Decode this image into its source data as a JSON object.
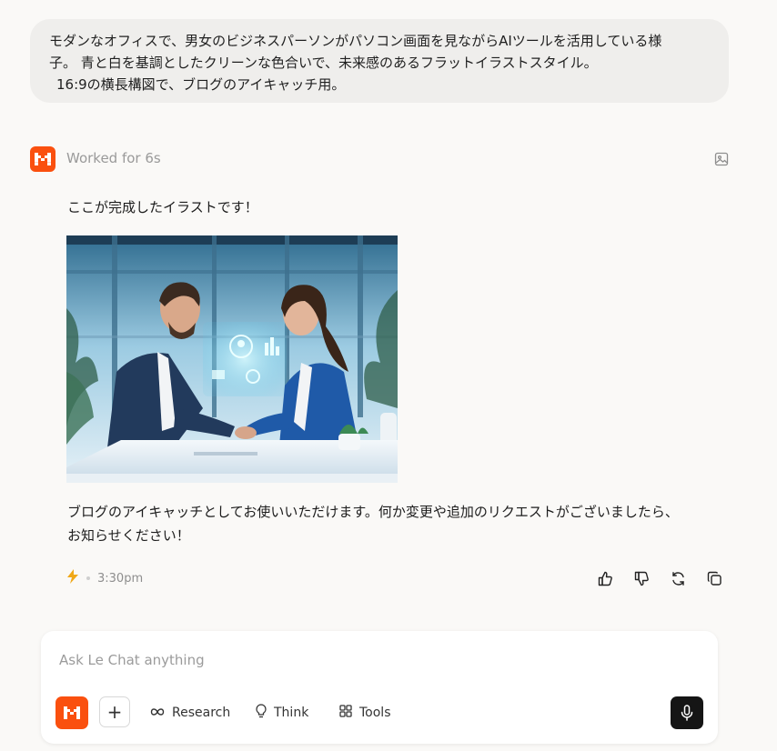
{
  "user_message": {
    "line1": "モダンなオフィスで、男女のビジネスパーソンがパソコン画面を見ながらAIツールを活用している様",
    "line2": "子。  青と白を基調としたクリーンな色合いで、未来感のあるフラットイラストスタイル。",
    "line3": "16:9の横長構図で、ブログのアイキャッチ用。"
  },
  "assistant": {
    "status": "Worked for 6s",
    "intro": "ここが完成したイラストです！",
    "outro_line1": "ブログのアイキャッチとしてお使いいただけます。何か変更や追加のリクエストがございましたら、",
    "outro_line2": "お知らせください！",
    "time": "3:30pm"
  },
  "composer": {
    "placeholder": "Ask Le Chat anything",
    "plus_label": "+",
    "research_label": "Research",
    "think_label": "Think",
    "tools_label": "Tools"
  },
  "icons": {
    "brand": "mistral-logo-icon",
    "image": "image-icon",
    "flash": "lightning-icon",
    "like": "thumbs-up-icon",
    "dislike": "thumbs-down-icon",
    "regenerate": "refresh-icon",
    "copy": "copy-icon",
    "research": "infinity-icon",
    "think": "lightbulb-icon",
    "tools": "grid-icon",
    "mic": "microphone-icon"
  },
  "colors": {
    "brand": "#fa500f",
    "background": "#faf9f7",
    "bubble": "#efeeec",
    "lightning": "#f0a818"
  }
}
